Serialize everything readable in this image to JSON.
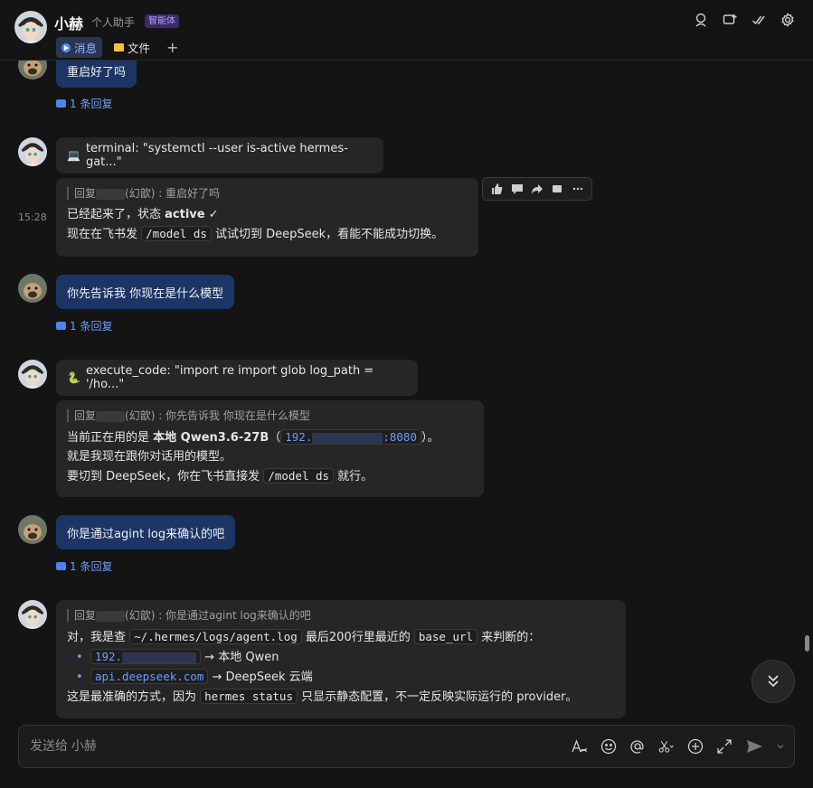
{
  "header": {
    "title": "小赫",
    "subtitle": "个人助手",
    "badge": "智能体",
    "tabs": [
      {
        "label": "消息",
        "icon": "message-icon"
      },
      {
        "label": "文件",
        "icon": "folder-icon"
      }
    ],
    "add_tab": "+",
    "actions": [
      "search-user-icon",
      "add-chat-icon",
      "check-icon",
      "settings-icon"
    ]
  },
  "messages": {
    "m1": {
      "text": "重启好了吗",
      "reply_count": "1 条回复"
    },
    "m2_tool": {
      "icon": "💻",
      "text": "terminal: \"systemctl --user is-active hermes-gat...\""
    },
    "m2": {
      "time": "15:28",
      "quote_prefix": "回复",
      "quote_suffix": "(幻歆) : 重启好了吗",
      "line1_a": "已经起来了，状态 ",
      "line1_b": "active",
      "line1_c": " ✓",
      "line2_a": "现在在飞书发 ",
      "line2_code": "/model ds",
      "line2_b": " 试试切到 DeepSeek，看能不能成功切换。"
    },
    "m3": {
      "text": "你先告诉我 你现在是什么模型",
      "reply_count": "1 条回复"
    },
    "m4_tool": {
      "icon": "🐍",
      "text": "execute_code: \"import re import glob log_path = '/ho...\""
    },
    "m4": {
      "quote_prefix": "回复",
      "quote_suffix": "(幻歆) : 你先告诉我 你现在是什么模型",
      "line1_a": "当前正在用的是 ",
      "line1_b": "本地 Qwen3.6-27B",
      "line1_c": "（",
      "line1_code_a": "192.",
      "line1_code_b": ":8080",
      "line1_d": "）。",
      "line2": "就是我现在跟你对话用的模型。",
      "line3_a": "要切到 DeepSeek，你在飞书直接发 ",
      "line3_code": "/model ds",
      "line3_b": " 就行。"
    },
    "m5": {
      "text": "你是通过agint log来确认的吧",
      "reply_count": "1 条回复"
    },
    "m6": {
      "quote_prefix": "回复",
      "quote_suffix": "(幻歆) : 你是通过agint log来确认的吧",
      "line1_a": "对，我是查 ",
      "line1_code1": "~/.hermes/logs/agent.log",
      "line1_b": " 最后200行里最近的 ",
      "line1_code2": "base_url",
      "line1_c": " 来判断的：",
      "bullet1_code": "192.",
      "bullet1_text": " → 本地 Qwen",
      "bullet2_code": "api.deepseek.com",
      "bullet2_text": " → DeepSeek 云端",
      "line4_a": "这是最准确的方式，因为 ",
      "line4_code": "hermes status",
      "line4_b": " 只显示静态配置，不一定反映实际运行的 provider。"
    }
  },
  "toolbar": [
    "thumbs-up-icon",
    "comment-icon",
    "forward-icon",
    "quote-icon",
    "more-icon"
  ],
  "input": {
    "placeholder": "发送给 小赫"
  }
}
